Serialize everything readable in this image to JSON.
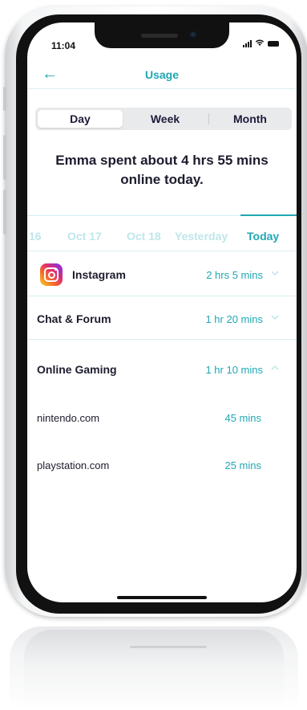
{
  "status_bar": {
    "time": "11:04"
  },
  "nav": {
    "back_icon": "←",
    "title": "Usage"
  },
  "segments": [
    {
      "label": "Day",
      "selected": true
    },
    {
      "label": "Week",
      "selected": false
    },
    {
      "label": "Month",
      "selected": false
    }
  ],
  "summary": "Emma spent about 4 hrs 55 mins online today.",
  "dates": [
    {
      "label": "16",
      "selected": false
    },
    {
      "label": "Oct 17",
      "selected": false
    },
    {
      "label": "Oct 18",
      "selected": false
    },
    {
      "label": "Yesterday",
      "selected": false
    },
    {
      "label": "Today",
      "selected": true
    }
  ],
  "categories": [
    {
      "name": "Instagram",
      "time": "2 hrs 5 mins",
      "icon": "instagram-icon",
      "chevron": "chevron-down-icon"
    },
    {
      "name": "Chat & Forum",
      "time": "1 hr 20 mins",
      "chevron": "chevron-down-icon"
    },
    {
      "name": "Online Gaming",
      "time": "1 hr 10 mins",
      "chevron": "chevron-up-icon",
      "sites": [
        {
          "domain": "nintendo.com",
          "time": "45 mins"
        },
        {
          "domain": "playstation.com",
          "time": "25 mins"
        }
      ]
    }
  ],
  "colors": {
    "accent": "#21a7b4",
    "accent_light": "#bfe6ea",
    "text_dark": "#1c1c2e",
    "segment_bg": "#e9eaec"
  }
}
